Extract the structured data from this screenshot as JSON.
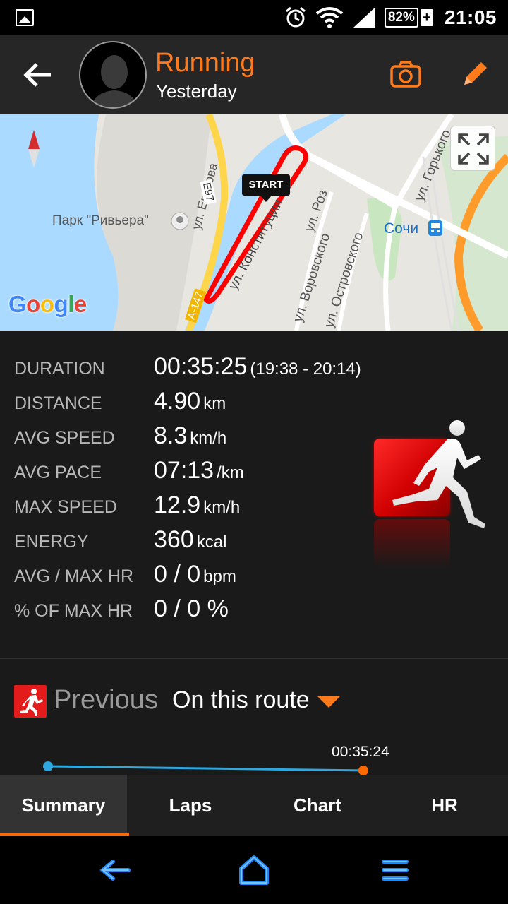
{
  "status_bar": {
    "battery": "82%",
    "battery_charging": "+",
    "time": "21:05",
    "icons": [
      "gallery-icon",
      "alarm-icon",
      "wifi-icon",
      "signal-icon",
      "battery-icon"
    ]
  },
  "header": {
    "title": "Running",
    "subtitle": "Yesterday",
    "accent_color": "#ff7a1a"
  },
  "map": {
    "start_label": "START",
    "attribution": "Google",
    "labels": {
      "park": "Парк \"Ривьера\"",
      "egorova": "ул. Егорова",
      "konstitucii": "ул. Конституции",
      "roz": "ул. Роз",
      "vorovskogo": "ул. Воровского",
      "ostrovskogo": "ул. Островского",
      "gorkogo": "ул. Горького",
      "sochi": "Сочи",
      "a147": "А-147",
      "e97": "E97"
    }
  },
  "stats": [
    {
      "label": "DURATION",
      "value": "00:35:25",
      "unit": "(19:38 - 20:14)"
    },
    {
      "label": "DISTANCE",
      "value": "4.90",
      "unit": "km"
    },
    {
      "label": "AVG SPEED",
      "value": "8.3",
      "unit": "km/h"
    },
    {
      "label": "AVG PACE",
      "value": "07:13",
      "unit": "/km"
    },
    {
      "label": "MAX SPEED",
      "value": "12.9",
      "unit": "km/h"
    },
    {
      "label": "ENERGY",
      "value": "360",
      "unit": "kcal"
    },
    {
      "label": "AVG / MAX HR",
      "value": "0 / 0",
      "unit": "bpm"
    },
    {
      "label": "% OF MAX HR",
      "value": "0 / 0 %",
      "unit": ""
    }
  ],
  "previous": {
    "label": "Previous",
    "route_filter": "On this route",
    "last_time": "00:35:24"
  },
  "tabs": [
    {
      "label": "Summary",
      "active": true
    },
    {
      "label": "Laps",
      "active": false
    },
    {
      "label": "Chart",
      "active": false
    },
    {
      "label": "HR",
      "active": false
    }
  ]
}
